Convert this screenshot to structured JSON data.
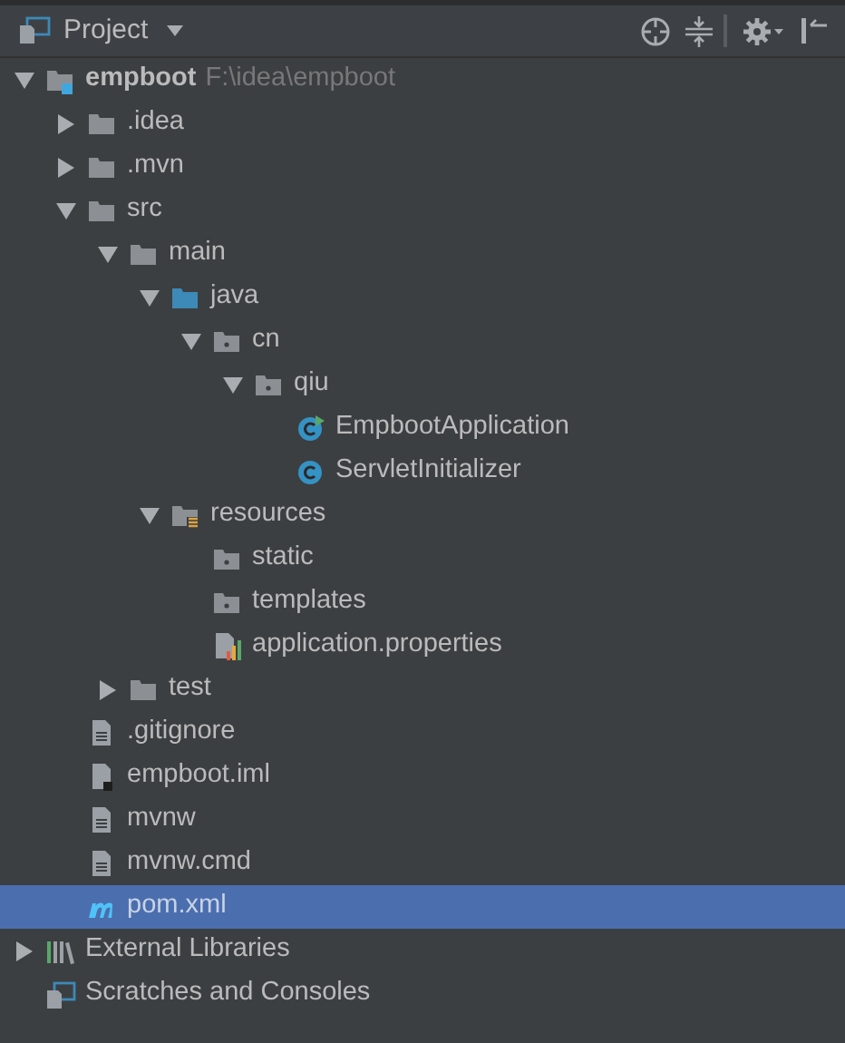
{
  "header": {
    "title": "Project"
  },
  "tree": [
    {
      "label": "empboot",
      "path": "F:\\idea\\empboot",
      "kind": "module",
      "expanded": true,
      "selected": false,
      "children": [
        {
          "label": ".idea",
          "kind": "folder",
          "expanded": false,
          "selected": false
        },
        {
          "label": ".mvn",
          "kind": "folder",
          "expanded": false,
          "selected": false
        },
        {
          "label": "src",
          "kind": "folder",
          "expanded": true,
          "selected": false,
          "children": [
            {
              "label": "main",
              "kind": "folder",
              "expanded": true,
              "selected": false,
              "children": [
                {
                  "label": "java",
                  "kind": "source_folder",
                  "expanded": true,
                  "selected": false,
                  "children": [
                    {
                      "label": "cn",
                      "kind": "package",
                      "expanded": true,
                      "selected": false,
                      "children": [
                        {
                          "label": "qiu",
                          "kind": "package",
                          "expanded": true,
                          "selected": false,
                          "children": [
                            {
                              "label": "EmpbootApplication",
                              "kind": "main_class",
                              "selected": false
                            },
                            {
                              "label": "ServletInitializer",
                              "kind": "class",
                              "selected": false
                            }
                          ]
                        }
                      ]
                    }
                  ]
                },
                {
                  "label": "resources",
                  "kind": "resources_folder",
                  "expanded": true,
                  "selected": false,
                  "children": [
                    {
                      "label": "static",
                      "kind": "package",
                      "selected": false
                    },
                    {
                      "label": "templates",
                      "kind": "package",
                      "selected": false
                    },
                    {
                      "label": "application.properties",
                      "kind": "properties",
                      "selected": false
                    }
                  ]
                }
              ]
            },
            {
              "label": "test",
              "kind": "folder",
              "expanded": false,
              "selected": false
            }
          ]
        },
        {
          "label": ".gitignore",
          "kind": "file",
          "selected": false
        },
        {
          "label": "empboot.iml",
          "kind": "iml",
          "selected": false
        },
        {
          "label": "mvnw",
          "kind": "file",
          "selected": false
        },
        {
          "label": "mvnw.cmd",
          "kind": "file",
          "selected": false
        },
        {
          "label": "pom.xml",
          "kind": "maven",
          "selected": true
        }
      ]
    },
    {
      "label": "External Libraries",
      "kind": "libraries",
      "expanded": false,
      "selected": false
    },
    {
      "label": "Scratches and Consoles",
      "kind": "scratches",
      "selected": false
    }
  ]
}
